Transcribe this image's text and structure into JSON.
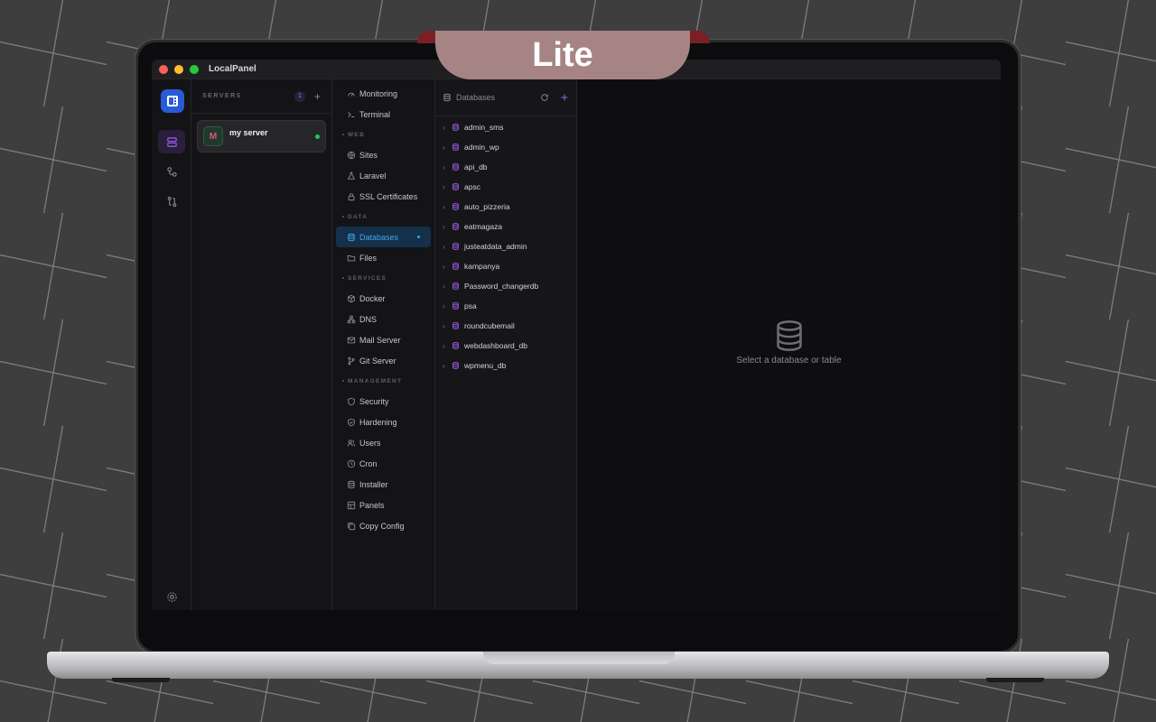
{
  "badge": {
    "label": "Lite"
  },
  "window": {
    "title": "LocalPanel"
  },
  "rail": {
    "items": [
      {
        "icon": "app-logo-icon"
      },
      {
        "icon": "servers-icon",
        "active": true
      },
      {
        "icon": "connections-icon"
      },
      {
        "icon": "sync-icon"
      },
      {
        "icon": "settings-icon"
      }
    ]
  },
  "servers": {
    "header": "SERVERS",
    "count": "1",
    "add_label": "+",
    "list": [
      {
        "initial": "M",
        "name": "my server",
        "status": "online"
      }
    ]
  },
  "nav": {
    "top": [
      {
        "label": "Monitoring",
        "icon": "gauge-icon"
      },
      {
        "label": "Terminal",
        "icon": "terminal-icon"
      }
    ],
    "sections": [
      {
        "title": "WEB",
        "items": [
          {
            "label": "Sites",
            "icon": "globe-icon"
          },
          {
            "label": "Laravel",
            "icon": "flask-icon"
          },
          {
            "label": "SSL Certificates",
            "icon": "lock-icon"
          }
        ]
      },
      {
        "title": "DATA",
        "items": [
          {
            "label": "Databases",
            "icon": "database-icon",
            "active": true
          },
          {
            "label": "Files",
            "icon": "folder-icon"
          }
        ]
      },
      {
        "title": "SERVICES",
        "items": [
          {
            "label": "Docker",
            "icon": "box-icon"
          },
          {
            "label": "DNS",
            "icon": "network-icon"
          },
          {
            "label": "Mail Server",
            "icon": "mail-icon"
          },
          {
            "label": "Git Server",
            "icon": "git-branch-icon"
          }
        ]
      },
      {
        "title": "MANAGEMENT",
        "items": [
          {
            "label": "Security",
            "icon": "shield-icon"
          },
          {
            "label": "Hardening",
            "icon": "shield-check-icon"
          },
          {
            "label": "Users",
            "icon": "users-icon"
          },
          {
            "label": "Cron",
            "icon": "clock-icon"
          },
          {
            "label": "Installer",
            "icon": "installer-icon"
          },
          {
            "label": "Panels",
            "icon": "panels-icon"
          },
          {
            "label": "Copy Config",
            "icon": "copy-icon"
          }
        ]
      }
    ]
  },
  "databases": {
    "title": "Databases",
    "list": [
      "admin_sms",
      "admin_wp",
      "api_db",
      "apsc",
      "auto_pizzeria",
      "eatmagaza",
      "justeatdata_admin",
      "kampanya",
      "Password_changerdb",
      "psa",
      "roundcubemail",
      "webdashboard_db",
      "wpmenu_db"
    ]
  },
  "main": {
    "empty_text": "Select a database or table"
  },
  "colors": {
    "accent_purple": "#9c5cf0",
    "accent_blue": "#3fa7e8",
    "online": "#22c55e",
    "badge": "#a78484"
  }
}
